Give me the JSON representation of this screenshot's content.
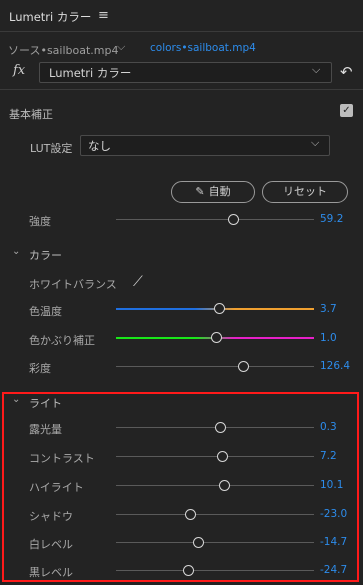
{
  "panel": {
    "title": "Lumetri カラー",
    "menu_icon": "≡"
  },
  "source": {
    "name": "ソース•sailboat.mp4",
    "clip": "colors•sailboat.mp4"
  },
  "effect": {
    "fx_label": "fx",
    "name": "Lumetri カラー"
  },
  "basic": {
    "label": "基本補正",
    "checked": true,
    "lut_label": "LUT設定",
    "lut_value": "なし",
    "auto_label": "自動",
    "reset_label": "リセット",
    "intensity": {
      "label": "強度",
      "value": "59.2",
      "position": 0.72
    }
  },
  "color": {
    "label": "カラー",
    "white_balance_label": "ホワイトバランス",
    "temperature": {
      "label": "色温度",
      "value": "3.7",
      "position": 0.52
    },
    "tint": {
      "label": "色かぶり補正",
      "value": "1.0",
      "position": 0.51
    },
    "saturation": {
      "label": "彩度",
      "value": "126.4",
      "position": 0.63
    }
  },
  "light": {
    "label": "ライト",
    "rows": [
      {
        "label": "露光量",
        "value": "0.3",
        "position": 0.53
      },
      {
        "label": "コントラスト",
        "value": "7.2",
        "position": 0.54
      },
      {
        "label": "ハイライト",
        "value": "10.1",
        "position": 0.55
      },
      {
        "label": "シャドウ",
        "value": "-23.0",
        "position": 0.38
      },
      {
        "label": "白レベル",
        "value": "-14.7",
        "position": 0.42
      },
      {
        "label": "黒レベル",
        "value": "-24.7",
        "position": 0.37
      }
    ]
  },
  "colors": {
    "accent": "#2d8ceb",
    "highlight": "#ff1a1a"
  }
}
